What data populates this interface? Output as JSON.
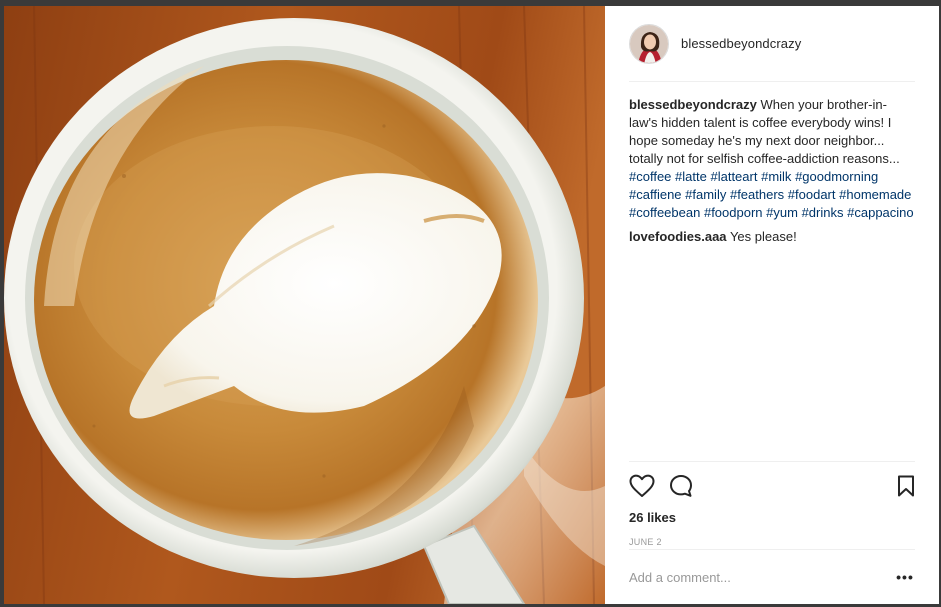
{
  "post": {
    "author": {
      "username": "blessedbeyondcrazy",
      "avatar_icon": "profile-photo"
    },
    "photo": {
      "icon": "latte-art-photo",
      "colors": {
        "table": "#a8531c",
        "cup": "#e9ece6",
        "coffee": "#c98f3c",
        "foam": "#fbf8f1"
      }
    },
    "caption": {
      "username": "blessedbeyondcrazy",
      "text": "When your brother-in-law's hidden talent is coffee everybody wins! I hope someday he's my next door neighbor... totally not for selfish coffee-addiction reasons...",
      "hashtags": [
        "#coffee",
        "#latte",
        "#latteart",
        "#milk",
        "#goodmorning",
        "#caffiene",
        "#family",
        "#feathers",
        "#foodart",
        "#homemade",
        "#coffeebean",
        "#foodporn",
        "#yum",
        "#drinks",
        "#cappacino"
      ]
    },
    "comments": [
      {
        "username": "lovefoodies.aaa",
        "text": "Yes please!"
      }
    ],
    "actions": {
      "like_icon": "heart-icon",
      "comment_icon": "comment-bubble-icon",
      "save_icon": "bookmark-icon"
    },
    "likes": "26 likes",
    "date": "JUNE 2",
    "comment_input": {
      "placeholder": "Add a comment...",
      "more_label": "•••"
    }
  }
}
